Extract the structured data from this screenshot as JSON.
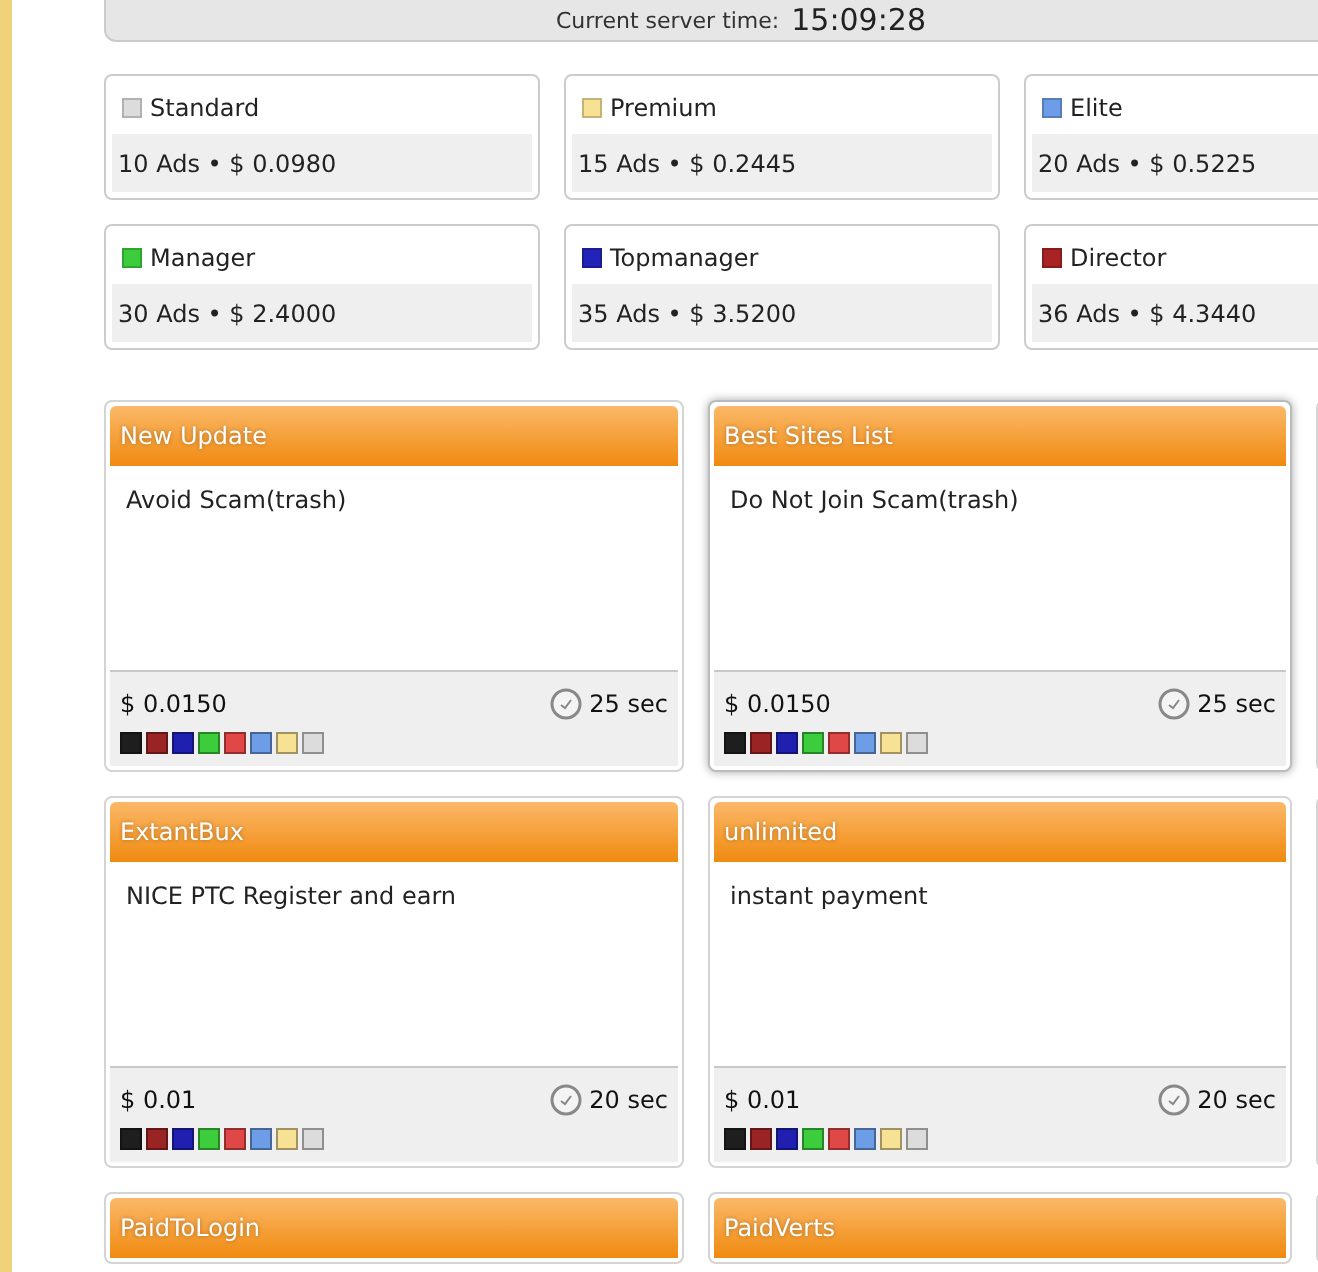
{
  "server_time": {
    "label": "Current server time:",
    "value": "15:09:28"
  },
  "levels": [
    {
      "name": "Standard",
      "color": "#dcdcdc",
      "ads": "10 Ads • $ 0.0980"
    },
    {
      "name": "Premium",
      "color": "#f7e195",
      "ads": "15 Ads • $ 0.2445"
    },
    {
      "name": "Elite",
      "color": "#6d9de6",
      "ads": "20 Ads • $ 0.5225"
    },
    {
      "name": "Manager",
      "color": "#3ccc3c",
      "ads": "30 Ads • $ 2.4000"
    },
    {
      "name": "Topmanager",
      "color": "#2323b8",
      "ads": "35 Ads • $ 3.5200"
    },
    {
      "name": "Director",
      "color": "#a82424",
      "ads": "36 Ads • $ 4.3440"
    }
  ],
  "ads": [
    {
      "title": "New Update",
      "description": "Avoid Scam(trash)",
      "price": "$ 0.0150",
      "duration": "25 sec",
      "selected": false,
      "badges": [
        {
          "color": "#1e1e1e"
        },
        {
          "color": "#9a2424"
        },
        {
          "color": "#2020b0"
        },
        {
          "color": "#3ccc3c"
        },
        {
          "color": "#e04848"
        },
        {
          "color": "#6d9de6"
        },
        {
          "color": "#f7e195"
        },
        {
          "color": "#dcdcdc"
        }
      ]
    },
    {
      "title": "Best Sites List",
      "description": "Do Not Join Scam(trash)",
      "price": "$ 0.0150",
      "duration": "25 sec",
      "selected": true,
      "badges": [
        {
          "color": "#1e1e1e"
        },
        {
          "color": "#9a2424"
        },
        {
          "color": "#2020b0"
        },
        {
          "color": "#3ccc3c"
        },
        {
          "color": "#e04848"
        },
        {
          "color": "#6d9de6"
        },
        {
          "color": "#f7e195"
        },
        {
          "color": "#dcdcdc"
        }
      ]
    },
    {
      "title": "ExtantBux",
      "description": "NICE PTC Register and earn",
      "price": "$ 0.01",
      "duration": "20 sec",
      "selected": false,
      "badges": [
        {
          "color": "#1e1e1e"
        },
        {
          "color": "#9a2424"
        },
        {
          "color": "#2020b0"
        },
        {
          "color": "#3ccc3c"
        },
        {
          "color": "#e04848"
        },
        {
          "color": "#6d9de6"
        },
        {
          "color": "#f7e195"
        },
        {
          "color": "#dcdcdc"
        }
      ]
    },
    {
      "title": "unlimited",
      "description": "instant payment",
      "price": "$ 0.01",
      "duration": "20 sec",
      "selected": false,
      "badges": [
        {
          "color": "#1e1e1e"
        },
        {
          "color": "#9a2424"
        },
        {
          "color": "#2020b0"
        },
        {
          "color": "#3ccc3c"
        },
        {
          "color": "#e04848"
        },
        {
          "color": "#6d9de6"
        },
        {
          "color": "#f7e195"
        },
        {
          "color": "#dcdcdc"
        }
      ]
    },
    {
      "title": "PaidToLogin"
    },
    {
      "title": "PaidVerts"
    }
  ]
}
